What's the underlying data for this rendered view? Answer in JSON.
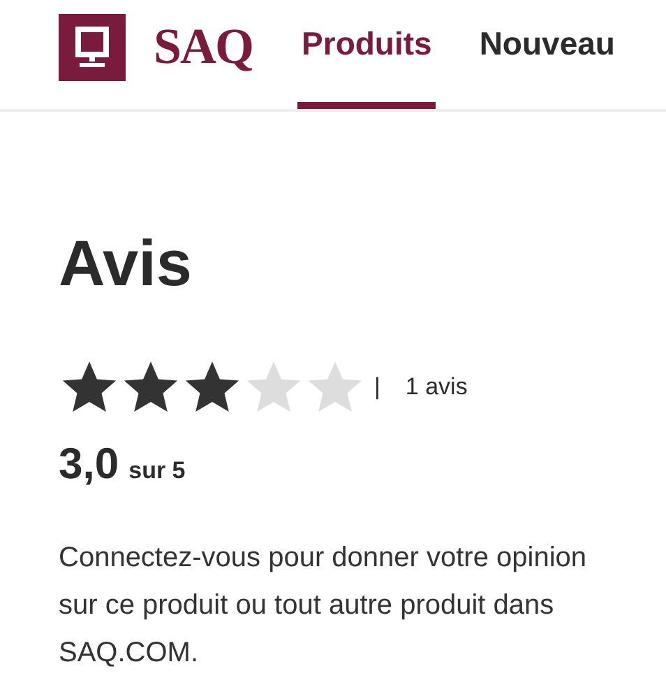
{
  "header": {
    "logo_text": "SAQ",
    "nav": [
      {
        "label": "Produits",
        "selected": true
      },
      {
        "label": "Nouveau",
        "selected": false
      }
    ]
  },
  "reviews": {
    "title": "Avis",
    "stars": 3,
    "separator": "|",
    "count": "1 avis",
    "score": "3,0",
    "score_suffix": "sur 5",
    "message": "Connectez-vous pour donner votre opinion sur ce produit ou tout autre produit dans SAQ.COM."
  }
}
